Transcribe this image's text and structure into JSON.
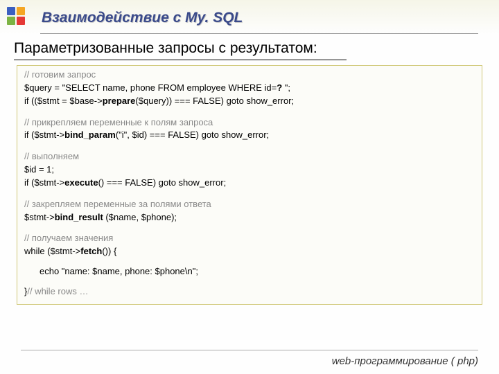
{
  "header": {
    "title": "Взаимодействие с My. SQL"
  },
  "subtitle": "Параметризованные запросы с результатом:",
  "code": {
    "b1_c": "// готовим запрос",
    "b1_l1a": "$query = \"SELECT name, phone FROM employee WHERE id=",
    "b1_l1b": "?",
    "b1_l1c": " \";",
    "b1_l2a": "if (($stmt = $base->",
    "b1_l2b": "prepare",
    "b1_l2c": "($query)) === FALSE) goto show_error;",
    "b2_c": "// прикрепляем переменные к полям запроса",
    "b2_l1a": "if ($stmt->",
    "b2_l1b": "bind_param",
    "b2_l1c": "(\"i\", $id) === FALSE) goto show_error;",
    "b3_c": "// выполняем",
    "b3_l1": "$id = 1;",
    "b3_l2a": "if ($stmt->",
    "b3_l2b": "execute",
    "b3_l2c": "() === FALSE) goto show_error;",
    "b4_c": "// закрепляем переменные за полями ответа",
    "b4_l1a": "$stmt->",
    "b4_l1b": "bind_result",
    "b4_l1c": " ($name, $phone);",
    "b5_c": "// получаем значения",
    "b5_l1a": "while ($stmt->",
    "b5_l1b": "fetch",
    "b5_l1c": "()) {",
    "b5_echo": "echo \"name: $name, phone: $phone\\n\";",
    "b5_close": "}",
    "b5_close_c": "// while rows …"
  },
  "footer": "web-программирование ( php)"
}
